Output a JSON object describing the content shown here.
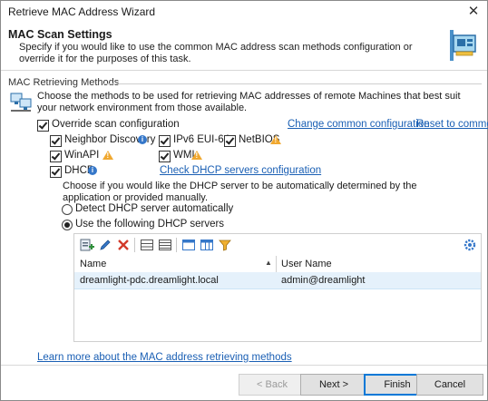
{
  "window": {
    "title": "Retrieve MAC Address Wizard",
    "close_glyph": "✕"
  },
  "header": {
    "title": "MAC Scan Settings",
    "description": "Specify if you would like to use the common MAC address scan methods configuration or override it for the purposes of this task.",
    "icon": "network-card-icon"
  },
  "section": {
    "label": "MAC Retrieving Methods",
    "intro": "Choose the methods to be used for retrieving MAC addresses of remote Machines that best suit your network environment from those available.",
    "icon": "network-machines-icon"
  },
  "override": {
    "label": "Override scan configuration",
    "checked": true
  },
  "links": {
    "change_common": "Change common configuration",
    "reset_common": "Reset to common",
    "check_dhcp": "Check DHCP servers configuration",
    "learn_more": "Learn more about the MAC address retrieving methods"
  },
  "methods": [
    {
      "label": "Neighbor Discovery",
      "checked": true,
      "badge": "info"
    },
    {
      "label": "IPv6 EUI-64",
      "checked": true,
      "badge": ""
    },
    {
      "label": "NetBIOS",
      "checked": true,
      "badge": "warning"
    },
    {
      "label": "WinAPI",
      "checked": true,
      "badge": "warning"
    },
    {
      "label": "WMI",
      "checked": true,
      "badge": "warning"
    },
    {
      "label": "DHCP",
      "checked": true,
      "badge": "info"
    }
  ],
  "dhcp": {
    "description": "Choose if you would like the DHCP server to be automatically determined by the application or provided manually.",
    "radio_auto": "Detect DHCP server automatically",
    "radio_manual": "Use the following DHCP servers",
    "selected": "manual"
  },
  "grid": {
    "columns": [
      "Name",
      "User Name"
    ],
    "rows": [
      {
        "name": "dreamlight-pdc.dreamlight.local",
        "user": "admin@dreamlight"
      }
    ],
    "toolbar": [
      "add-icon",
      "edit-icon",
      "delete-icon",
      "expand-icon",
      "collapse-icon",
      "layout-icon",
      "columns-icon",
      "filter-icon",
      "settings-icon"
    ]
  },
  "buttons": {
    "back": "< Back",
    "next": "Next >",
    "finish": "Finish",
    "cancel": "Cancel"
  },
  "colors": {
    "link": "#1a5fb4",
    "info": "#3577c9",
    "warning": "#f0a830",
    "selection": "#e5f1fb",
    "accent": "#0078d7"
  }
}
